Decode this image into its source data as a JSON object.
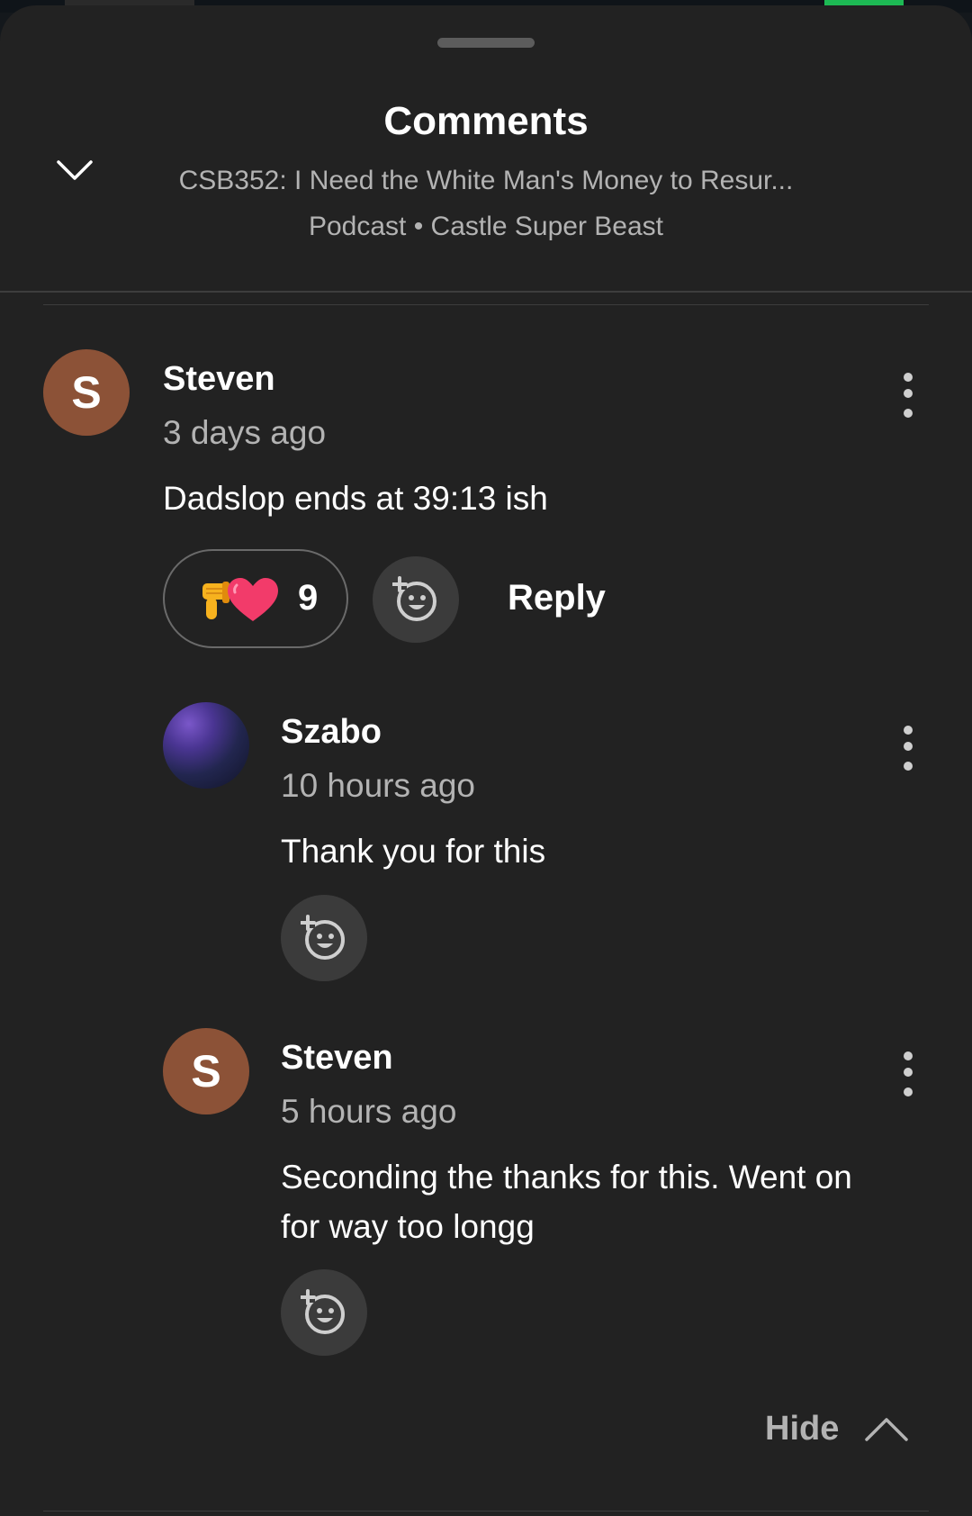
{
  "header": {
    "title": "Comments",
    "episode_title": "CSB352: I Need the White Man's Money to Resur...",
    "meta": "Podcast • Castle Super Beast"
  },
  "comments": [
    {
      "author": "Steven",
      "avatar_letter": "S",
      "time": "3 days ago",
      "text": "Dadslop ends at 39:13 ish",
      "reaction_count": "9",
      "reply_label": "Reply"
    },
    {
      "author": "Szabo",
      "time": "10 hours ago",
      "text": "Thank you for this"
    },
    {
      "author": "Steven",
      "avatar_letter": "S",
      "time": "5 hours ago",
      "text_line1": "Seconding the thanks for this. Went on",
      "text_line2": "for way too longg"
    }
  ],
  "footer": {
    "hide_label": "Hide"
  },
  "colors": {
    "sheet": "#222222",
    "avatar_bg": "#8c5237",
    "muted_text": "#b3b3b3",
    "pill_border": "#6a6a6a"
  }
}
